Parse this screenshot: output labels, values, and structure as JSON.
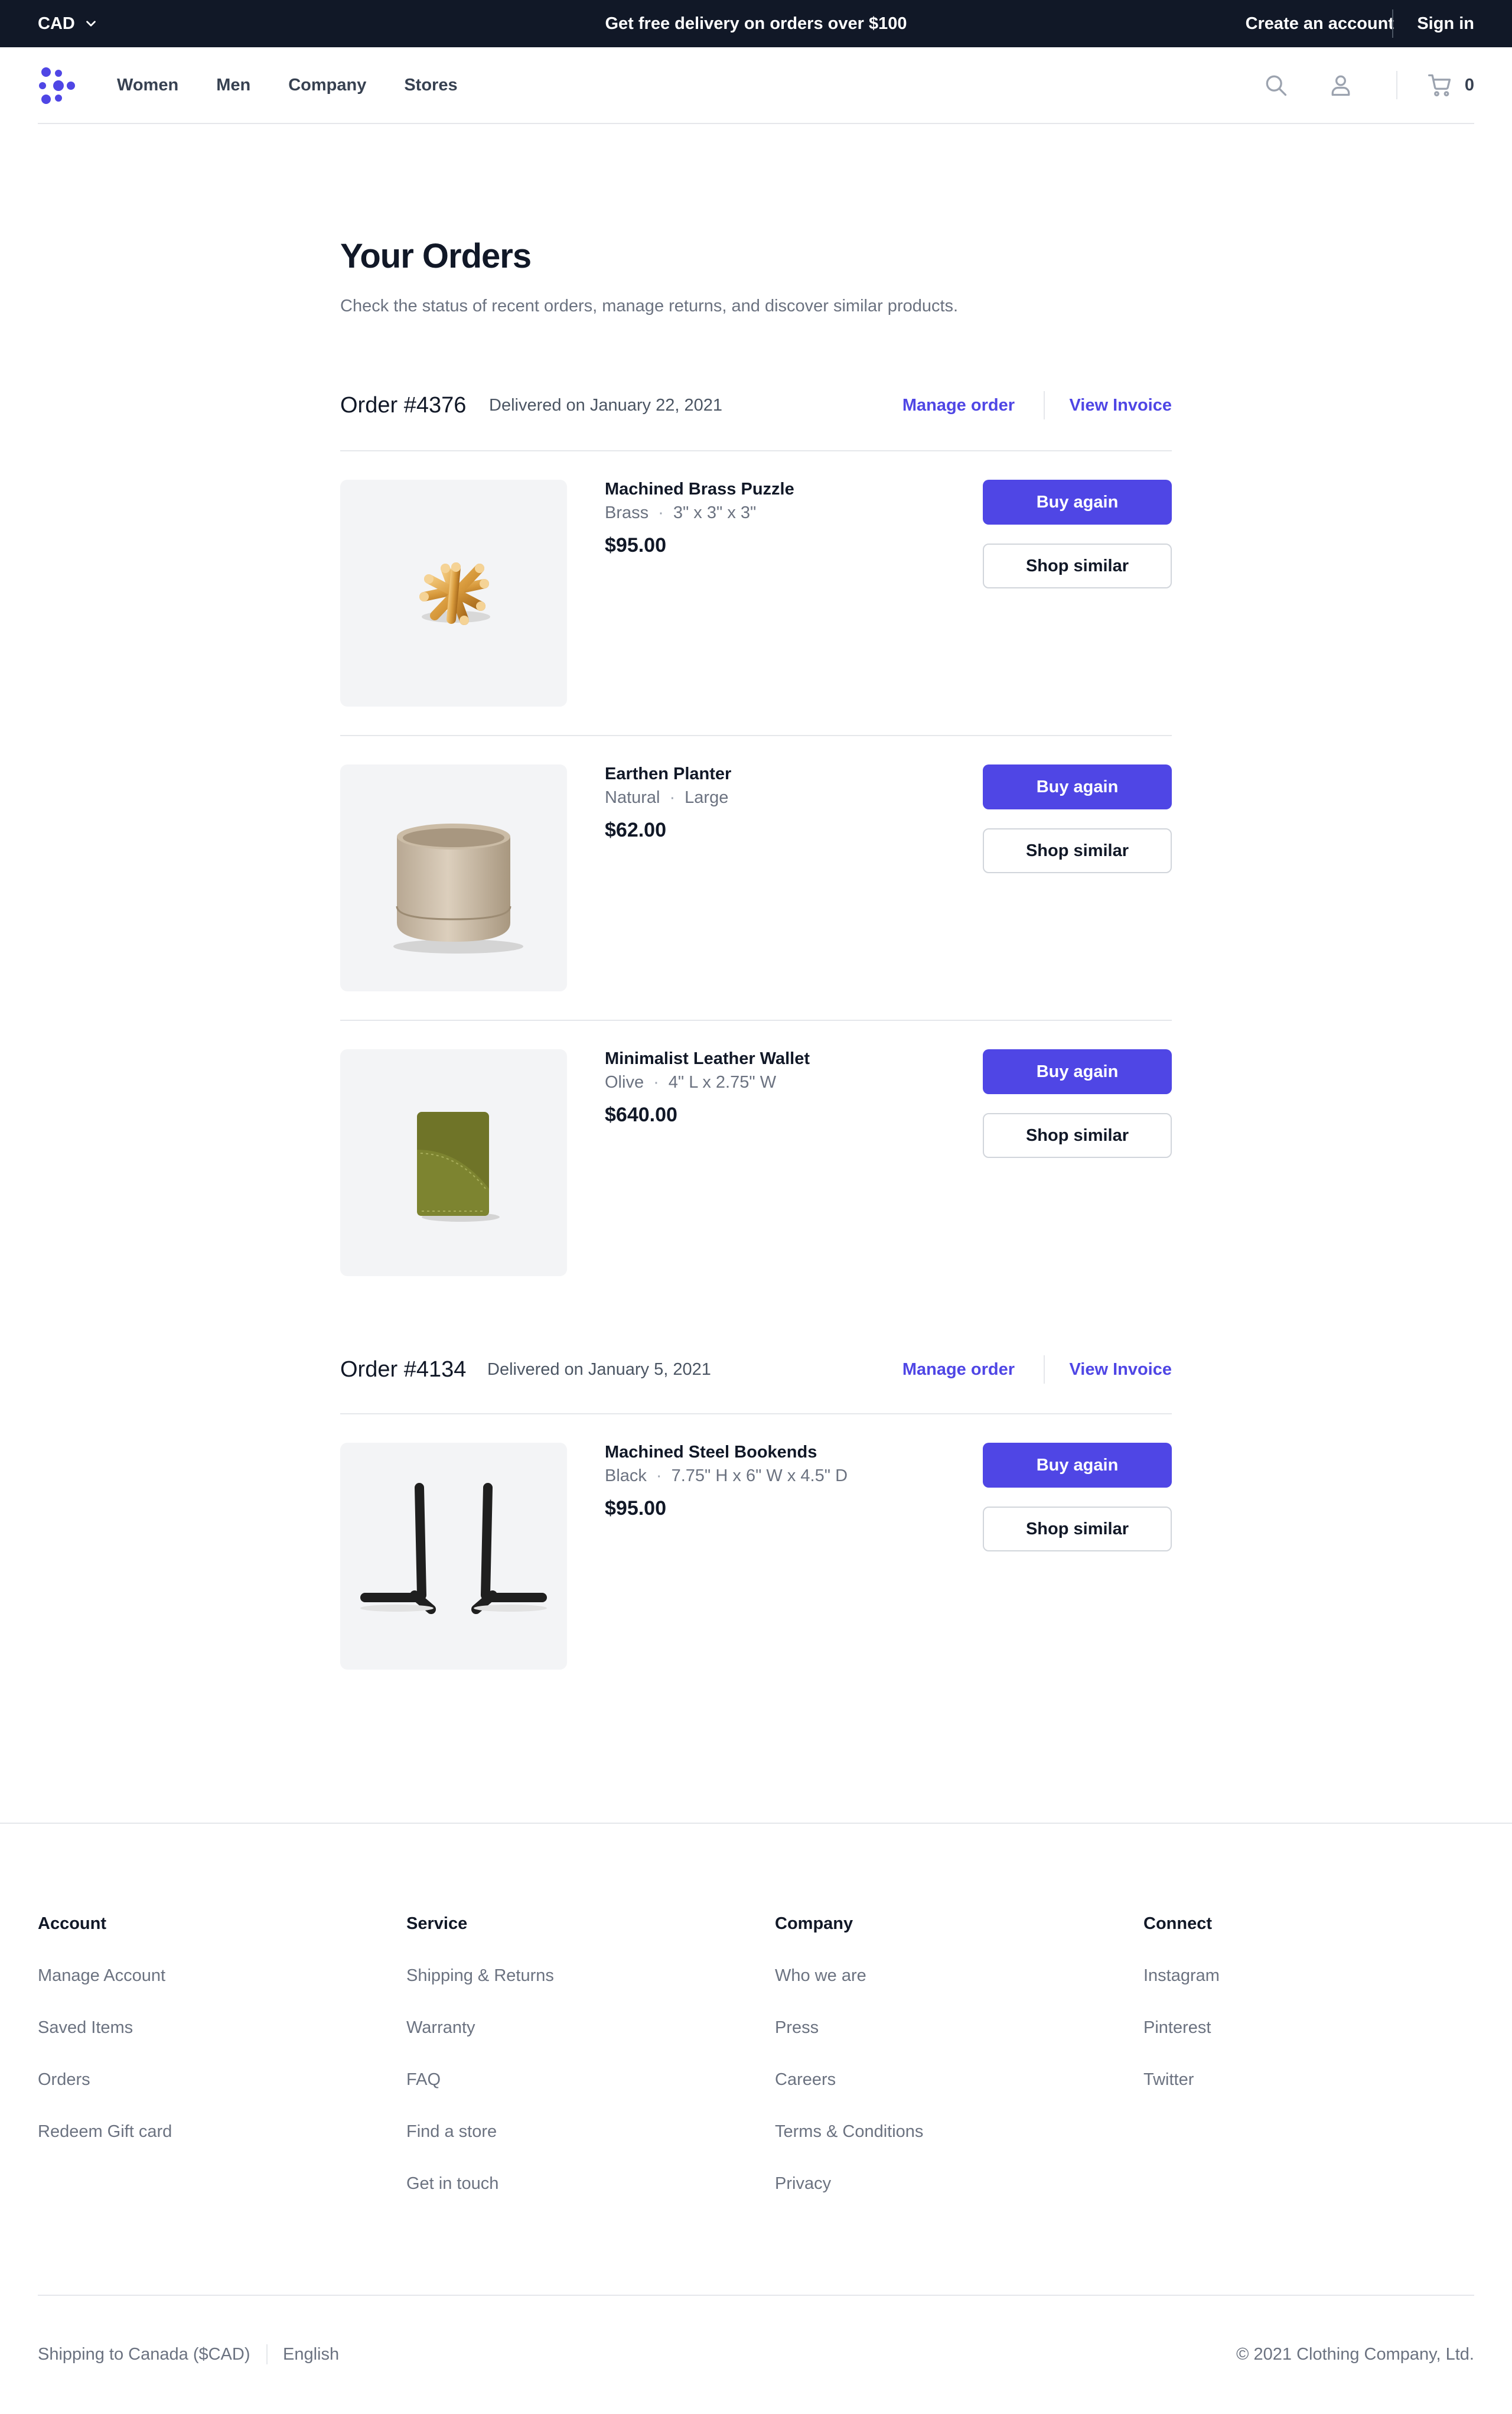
{
  "banner": {
    "currency": "CAD",
    "message": "Get free delivery on orders over $100",
    "create_account": "Create an account",
    "sign_in": "Sign in"
  },
  "header": {
    "nav": [
      "Women",
      "Men",
      "Company",
      "Stores"
    ],
    "cart_count": "0"
  },
  "page": {
    "title": "Your Orders",
    "subtitle": "Check the status of recent orders, manage returns, and discover similar products."
  },
  "orders": [
    {
      "title": "Order #4376",
      "date": "Delivered on January 22, 2021",
      "manage_label": "Manage order",
      "invoice_label": "View Invoice",
      "items": [
        {
          "name": "Machined Brass Puzzle",
          "color": "Brass",
          "size": "3\" x 3\" x 3\"",
          "price": "$95.00",
          "buy_label": "Buy again",
          "similar_label": "Shop similar"
        },
        {
          "name": "Earthen Planter",
          "color": "Natural",
          "size": "Large",
          "price": "$62.00",
          "buy_label": "Buy again",
          "similar_label": "Shop similar"
        },
        {
          "name": "Minimalist Leather Wallet",
          "color": "Olive",
          "size": "4\" L x 2.75\" W",
          "price": "$640.00",
          "buy_label": "Buy again",
          "similar_label": "Shop similar"
        }
      ]
    },
    {
      "title": "Order #4134",
      "date": "Delivered on January 5, 2021",
      "manage_label": "Manage order",
      "invoice_label": "View Invoice",
      "items": [
        {
          "name": "Machined Steel Bookends",
          "color": "Black",
          "size": "7.75\" H x 6\" W x 4.5\" D",
          "price": "$95.00",
          "buy_label": "Buy again",
          "similar_label": "Shop similar"
        }
      ]
    }
  ],
  "footer": {
    "columns": [
      {
        "title": "Account",
        "links": [
          "Manage Account",
          "Saved Items",
          "Orders",
          "Redeem Gift card"
        ]
      },
      {
        "title": "Service",
        "links": [
          "Shipping & Returns",
          "Warranty",
          "FAQ",
          "Find a store",
          "Get in touch"
        ]
      },
      {
        "title": "Company",
        "links": [
          "Who we are",
          "Press",
          "Careers",
          "Terms & Conditions",
          "Privacy"
        ]
      },
      {
        "title": "Connect",
        "links": [
          "Instagram",
          "Pinterest",
          "Twitter"
        ]
      }
    ],
    "shipping": "Shipping to Canada ($CAD)",
    "language": "English",
    "copyright": "© 2021 Clothing Company, Ltd."
  },
  "colors": {
    "accent": "#4f46e5",
    "banner_bg": "#111827",
    "muted_text": "#6b7280",
    "border": "#e5e7eb"
  },
  "icons": [
    "chevron-down-icon",
    "logo-icon",
    "search-icon",
    "user-icon",
    "cart-icon"
  ]
}
